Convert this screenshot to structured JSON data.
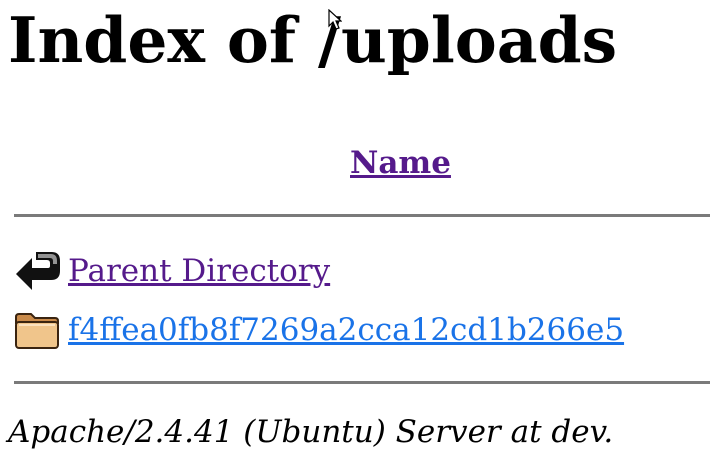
{
  "page": {
    "title": "Index of /uploads"
  },
  "table": {
    "column_header": "Name",
    "rows": [
      {
        "icon": "back-arrow-icon",
        "label": "Parent Directory"
      },
      {
        "icon": "folder-icon",
        "label": "f4ffea0fb8f7269a2cca12cd1b266e5"
      }
    ]
  },
  "footer": {
    "text": "Apache/2.4.41 (Ubuntu) Server at dev."
  },
  "colors": {
    "visited_link": "#551a8b",
    "link": "#1a73e8",
    "rule": "#7a7a7a"
  },
  "icons": {
    "cursor": "mouse-pointer-icon"
  }
}
